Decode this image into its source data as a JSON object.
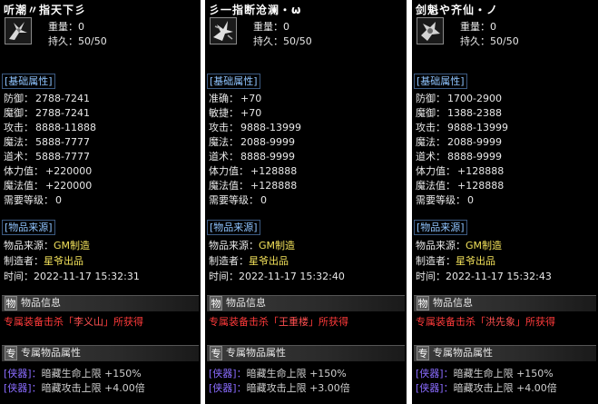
{
  "panels": [
    {
      "title": "听潮〃指天下彡",
      "weight_label": "重量：",
      "weight": "0",
      "durability_label": "持久：",
      "durability": "50/50",
      "basic_header": "[基础属性]",
      "attrs": [
        {
          "k": "防御：",
          "v": "2788-7241"
        },
        {
          "k": "魔御：",
          "v": "2788-7241"
        },
        {
          "k": "攻击：",
          "v": "8888-11888"
        },
        {
          "k": "魔法：",
          "v": "5888-7777"
        },
        {
          "k": "道术：",
          "v": "5888-7777"
        },
        {
          "k": "体力值：",
          "v": "+220000"
        },
        {
          "k": "魔法值：",
          "v": "+220000"
        },
        {
          "k": "需要等级：",
          "v": "0"
        }
      ],
      "source_header": "[物品来源]",
      "source_label": "物品来源：",
      "source_value": "GM制造",
      "maker_label": "制造者：",
      "maker_value": "星爷出品",
      "time_label": "时间：",
      "time_value": "2022-11-17 15:32:31",
      "info_tag": "物",
      "info_title": "物品信息",
      "owner_prefix": "专属装备击杀「",
      "owner_name": "李义山",
      "owner_suffix": "」所获得",
      "exclusive_tag": "专",
      "exclusive_title": "专属物品属性",
      "ex1_bracket": "[侠器]：",
      "ex1_text": "暗藏生命上限 +150%",
      "ex2_bracket": "[侠器]：",
      "ex2_text": "暗藏攻击上限 +4.00倍"
    },
    {
      "title": "彡一指断沧澜・ω",
      "weight_label": "重量：",
      "weight": "0",
      "durability_label": "持久：",
      "durability": "50/50",
      "basic_header": "[基础属性]",
      "attrs": [
        {
          "k": "准确：",
          "v": "+70"
        },
        {
          "k": "敏捷：",
          "v": "+70"
        },
        {
          "k": "攻击：",
          "v": "9888-13999"
        },
        {
          "k": "魔法：",
          "v": "2088-9999"
        },
        {
          "k": "道术：",
          "v": "8888-9999"
        },
        {
          "k": "体力值：",
          "v": "+128888"
        },
        {
          "k": "魔法值：",
          "v": "+128888"
        },
        {
          "k": "需要等级：",
          "v": "0"
        }
      ],
      "source_header": "[物品来源]",
      "source_label": "物品来源：",
      "source_value": "GM制造",
      "maker_label": "制造者：",
      "maker_value": "星爷出品",
      "time_label": "时间：",
      "time_value": "2022-11-17 15:32:40",
      "info_tag": "物",
      "info_title": "物品信息",
      "owner_prefix": "专属装备击杀「",
      "owner_name": "王重楼",
      "owner_suffix": "」所获得",
      "exclusive_tag": "专",
      "exclusive_title": "专属物品属性",
      "ex1_bracket": "[侠器]：",
      "ex1_text": "暗藏生命上限 +150%",
      "ex2_bracket": "[侠器]：",
      "ex2_text": "暗藏攻击上限 +3.00倍"
    },
    {
      "title": "剑魁や齐仙・ノ",
      "weight_label": "重量：",
      "weight": "0",
      "durability_label": "持久：",
      "durability": "50/50",
      "basic_header": "[基础属性]",
      "attrs": [
        {
          "k": "防御：",
          "v": "1700-2900"
        },
        {
          "k": "魔御：",
          "v": "1388-2388"
        },
        {
          "k": "攻击：",
          "v": "9888-13999"
        },
        {
          "k": "魔法：",
          "v": "2088-9999"
        },
        {
          "k": "道术：",
          "v": "8888-9999"
        },
        {
          "k": "体力值：",
          "v": "+128888"
        },
        {
          "k": "魔法值：",
          "v": "+128888"
        },
        {
          "k": "需要等级：",
          "v": "0"
        }
      ],
      "source_header": "[物品来源]",
      "source_label": "物品来源：",
      "source_value": "GM制造",
      "maker_label": "制造者：",
      "maker_value": "星爷出品",
      "time_label": "时间：",
      "time_value": "2022-11-17 15:32:43",
      "info_tag": "物",
      "info_title": "物品信息",
      "owner_prefix": "专属装备击杀「",
      "owner_name": "洪先象",
      "owner_suffix": "」所获得",
      "exclusive_tag": "专",
      "exclusive_title": "专属物品属性",
      "ex1_bracket": "[侠器]：",
      "ex1_text": "暗藏生命上限 +150%",
      "ex2_bracket": "[侠器]：",
      "ex2_text": "暗藏攻击上限 +4.00倍"
    }
  ]
}
